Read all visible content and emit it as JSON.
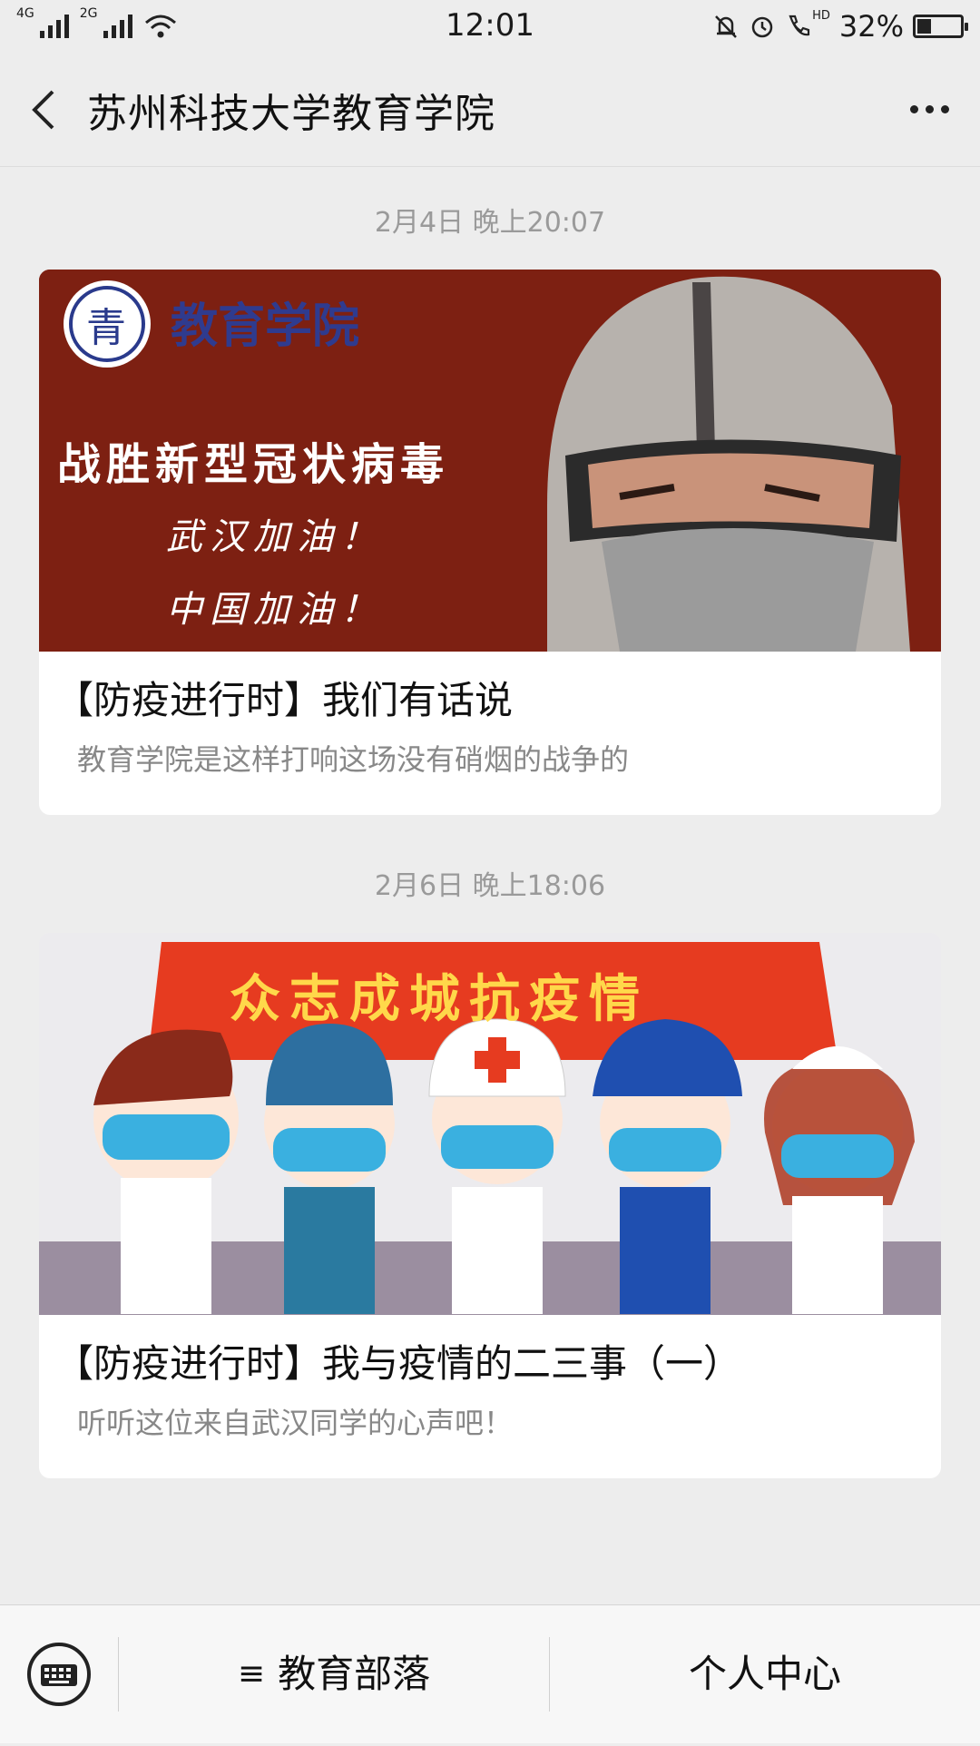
{
  "status": {
    "network1": "4G",
    "network2": "2G",
    "time": "12:01",
    "hd": "HD",
    "battery_pct": "32%",
    "battery_level": 0.32
  },
  "header": {
    "title": "苏州科技大学教育学院",
    "back_icon": "chevron-left-icon",
    "more_icon": "more-dots-icon"
  },
  "articles": [
    {
      "timestamp": "2月4日 晚上20:07",
      "title": "【防疫进行时】我们有话说",
      "desc": "教育学院是这样打响这场没有硝烟的战争的",
      "image": {
        "brand": "教育学院",
        "logo_char": "青",
        "lines": [
          "战胜新型冠状病毒",
          "武汉加油！",
          "中国加油！"
        ]
      }
    },
    {
      "timestamp": "2月6日 晚上18:06",
      "title": "【防疫进行时】我与疫情的二三事（一）",
      "desc": "听听这位来自武汉同学的心声吧！",
      "image": {
        "banner": "众志成城抗疫情"
      }
    }
  ],
  "bottom": {
    "keyboard_icon": "keyboard-icon",
    "menu_icon_glyph": "≡",
    "menu1": "教育部落",
    "menu2": "个人中心"
  }
}
